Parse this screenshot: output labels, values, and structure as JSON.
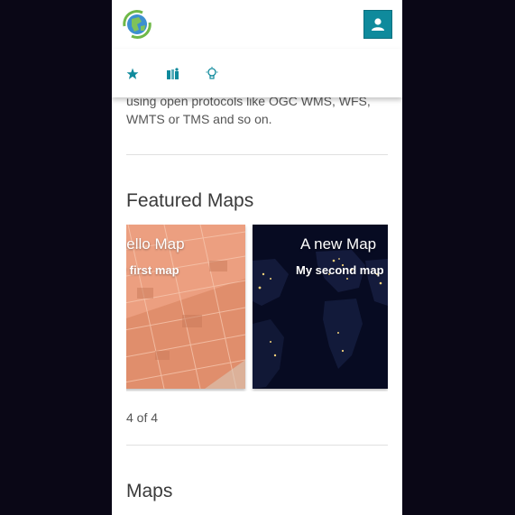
{
  "header": {
    "logo_icon": "globe-logo-icon",
    "account_icon": "user-icon",
    "accent_color": "#0f8a9c"
  },
  "nav": {
    "items": [
      {
        "icon": "star-icon"
      },
      {
        "icon": "maps-icon"
      },
      {
        "icon": "lightbulb-icon"
      }
    ]
  },
  "intro": {
    "text": "using open protocols like OGC WMS, WFS, WMTS or TMS and so on."
  },
  "featured": {
    "title": "Featured Maps",
    "cards": [
      {
        "title": "Hello Map",
        "description": "My first map"
      },
      {
        "title": "A new Map",
        "description": "My second map"
      }
    ],
    "pager": "4 of 4"
  },
  "maps_section": {
    "title": "Maps"
  }
}
